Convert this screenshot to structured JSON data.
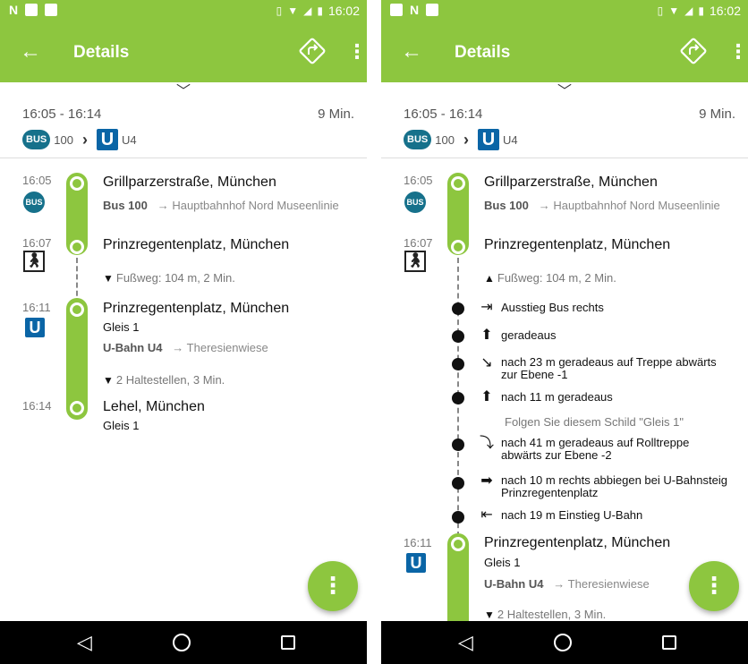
{
  "status": {
    "time": "16:02"
  },
  "appbar": {
    "title": "Details",
    "back_icon": "arrow-back-icon",
    "route_icon": "directions-icon",
    "more_icon": "more-vert-icon"
  },
  "summary": {
    "time_range": "16:05 - 16:14",
    "duration": "9 Min.",
    "bus_badge": "BUS",
    "bus_line": "100",
    "ubahn_badge": "U",
    "ubahn_line": "U4"
  },
  "left": {
    "stops": [
      {
        "time": "16:05",
        "name": "Grillparzerstraße, München",
        "line_label": "Bus 100",
        "direction": "→ Hauptbahnhof Nord Museenlinie"
      },
      {
        "time": "16:07",
        "name": "Prinzregentenplatz, München",
        "walk_toggle": "Fußweg: 104 m, 2 Min."
      },
      {
        "time": "16:11",
        "name": "Prinzregentenplatz, München",
        "platform": "Gleis 1",
        "line_label": "U-Bahn U4",
        "direction": "→ Theresienwiese",
        "stops_toggle": "2 Haltestellen, 3 Min."
      },
      {
        "time": "16:14",
        "name": "Lehel, München",
        "platform": "Gleis 1"
      }
    ]
  },
  "right": {
    "stops": [
      {
        "time": "16:05",
        "name": "Grillparzerstraße, München",
        "line_label": "Bus 100",
        "direction": "→ Hauptbahnhof Nord Museenlinie"
      },
      {
        "time": "16:07",
        "name": "Prinzregentenplatz, München",
        "walk_toggle": "Fußweg: 104 m, 2 Min."
      },
      {
        "time": "16:11",
        "name": "Prinzregentenplatz, München",
        "platform": "Gleis 1",
        "line_label": "U-Bahn U4",
        "direction": "→ Theresienwiese",
        "stops_toggle": "2 Haltestellen, 3 Min."
      }
    ],
    "instructions": [
      {
        "icon": "exit-icon",
        "text": "Ausstieg Bus  rechts"
      },
      {
        "icon": "arrow-up-icon",
        "text": "geradeaus"
      },
      {
        "icon": "stairs-down-icon",
        "text": "nach 23 m geradeaus auf Treppe abwärts",
        "text2": "zur Ebene -1"
      },
      {
        "icon": "arrow-up-icon",
        "text": "nach 11 m geradeaus"
      },
      {
        "icon": "escalator-icon",
        "text": "nach 41 m geradeaus auf Rolltreppe",
        "text2": "abwärts zur Ebene -2"
      },
      {
        "icon": "arrow-right-icon",
        "text": "nach 10 m rechts abbiegen bei U-Bahnsteig",
        "text2": "Prinzregentenplatz"
      },
      {
        "icon": "enter-icon",
        "text": "nach 19 m  Einstieg U-Bahn"
      }
    ],
    "hint": "Folgen Sie diesem Schild \"Gleis 1\""
  },
  "colors": {
    "accent": "#8dc63f",
    "bus": "#16718b",
    "ubahn": "#0a65a6"
  }
}
